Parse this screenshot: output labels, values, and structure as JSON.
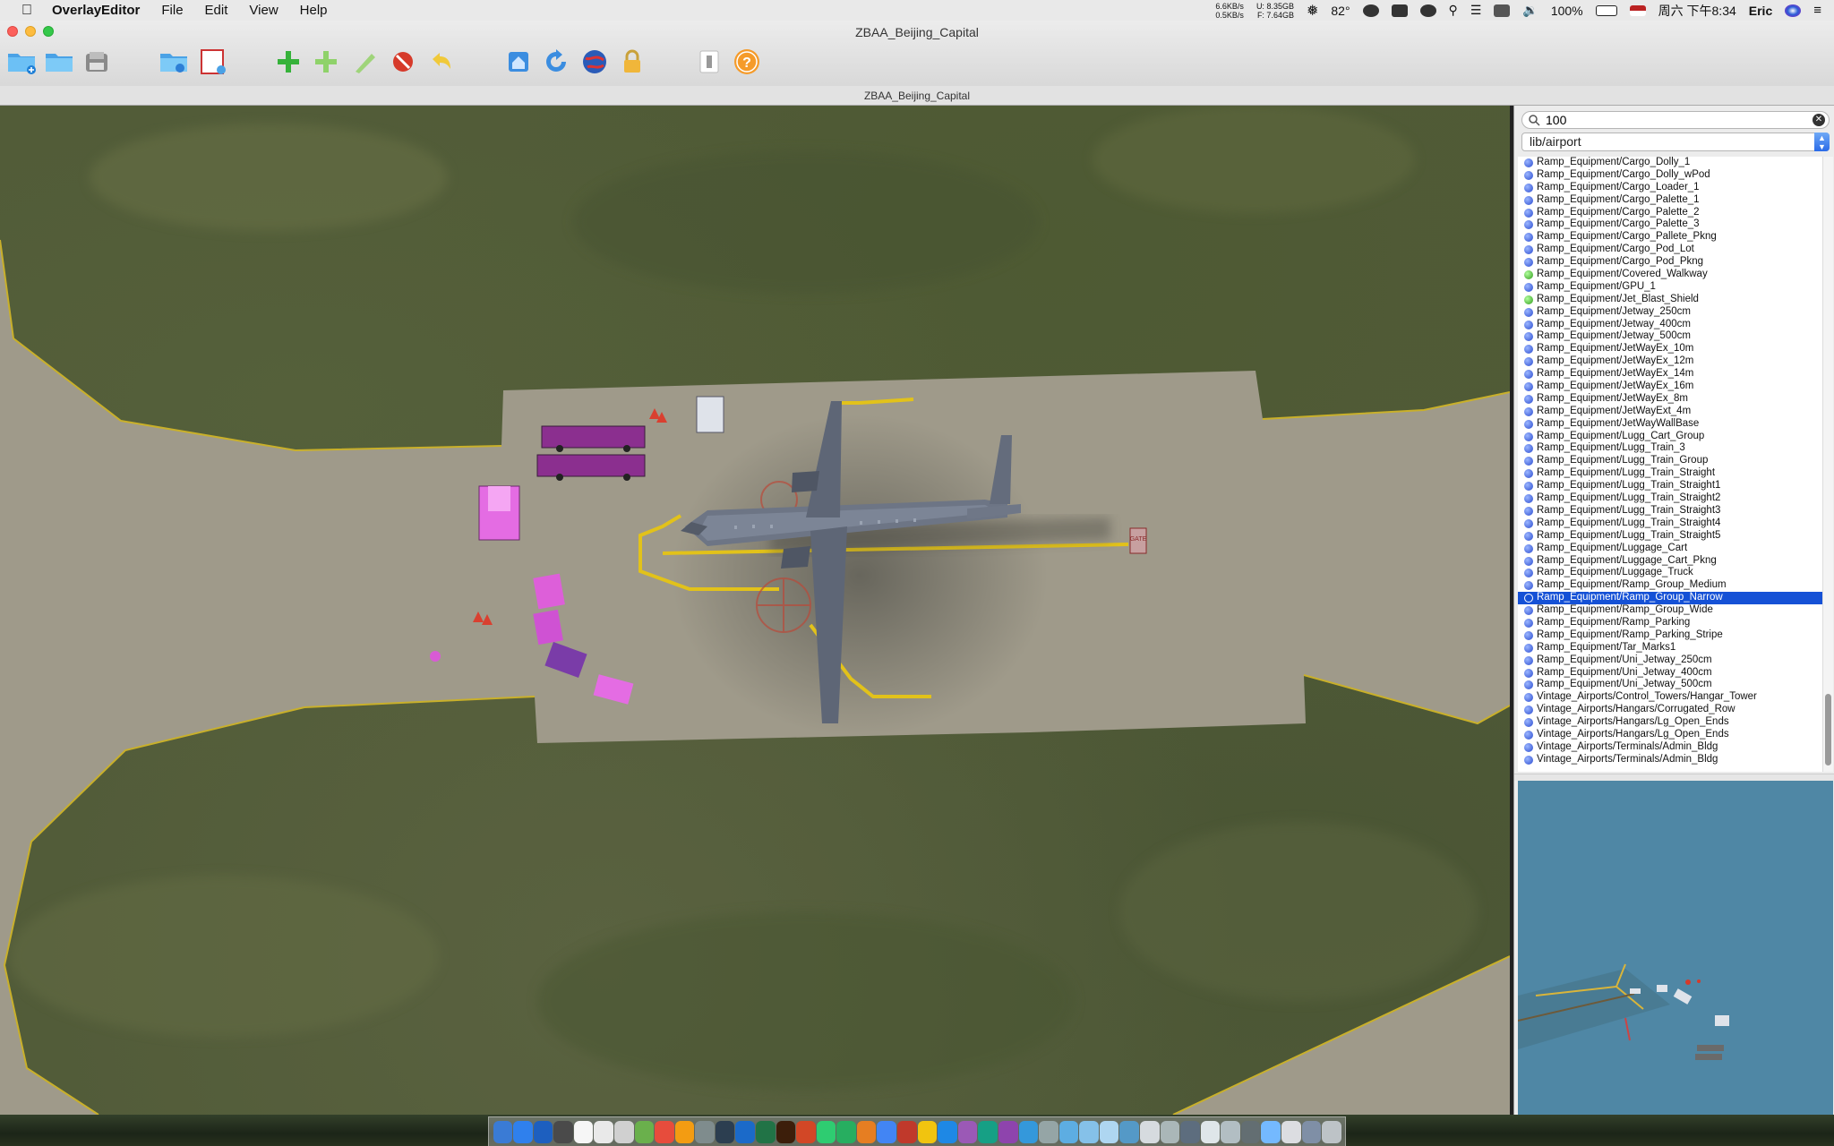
{
  "menubar": {
    "app_name": "OverlayEditor",
    "menus": [
      "File",
      "Edit",
      "View",
      "Help"
    ],
    "net_up": "6.6KB/s",
    "net_down": "0.5KB/s",
    "mem_used": "U: 8.35GB",
    "mem_free": "F: 7.64GB",
    "temperature": "82°",
    "battery": "100%",
    "datetime": "周六 下午8:34",
    "user": "Eric"
  },
  "window": {
    "title": "ZBAA_Beijing_Capital",
    "document_title": "ZBAA_Beijing_Capital"
  },
  "toolbar": {
    "icons": [
      "new-folder-icon",
      "open-folder-icon",
      "save-icon",
      "import-folder-icon",
      "import-image-icon",
      "add-object-icon",
      "add-polygon-icon",
      "edit-node-icon",
      "delete-icon",
      "undo-icon",
      "home-view-icon",
      "rotate-icon",
      "globe-icon",
      "lock-icon",
      "preferences-icon",
      "help-icon"
    ]
  },
  "panel": {
    "search_value": "100",
    "library_path": "lib/airport",
    "items": [
      {
        "label": "Ramp_Equipment/Cargo_Dolly_1",
        "color": "blue"
      },
      {
        "label": "Ramp_Equipment/Cargo_Dolly_wPod",
        "color": "blue"
      },
      {
        "label": "Ramp_Equipment/Cargo_Loader_1",
        "color": "blue"
      },
      {
        "label": "Ramp_Equipment/Cargo_Palette_1",
        "color": "blue"
      },
      {
        "label": "Ramp_Equipment/Cargo_Palette_2",
        "color": "blue"
      },
      {
        "label": "Ramp_Equipment/Cargo_Palette_3",
        "color": "blue"
      },
      {
        "label": "Ramp_Equipment/Cargo_Pallete_Pkng",
        "color": "blue"
      },
      {
        "label": "Ramp_Equipment/Cargo_Pod_Lot",
        "color": "blue"
      },
      {
        "label": "Ramp_Equipment/Cargo_Pod_Pkng",
        "color": "blue"
      },
      {
        "label": "Ramp_Equipment/Covered_Walkway",
        "color": "green"
      },
      {
        "label": "Ramp_Equipment/GPU_1",
        "color": "blue"
      },
      {
        "label": "Ramp_Equipment/Jet_Blast_Shield",
        "color": "green"
      },
      {
        "label": "Ramp_Equipment/Jetway_250cm",
        "color": "blue"
      },
      {
        "label": "Ramp_Equipment/Jetway_400cm",
        "color": "blue"
      },
      {
        "label": "Ramp_Equipment/Jetway_500cm",
        "color": "blue"
      },
      {
        "label": "Ramp_Equipment/JetWayEx_10m",
        "color": "blue"
      },
      {
        "label": "Ramp_Equipment/JetWayEx_12m",
        "color": "blue"
      },
      {
        "label": "Ramp_Equipment/JetWayEx_14m",
        "color": "blue"
      },
      {
        "label": "Ramp_Equipment/JetWayEx_16m",
        "color": "blue"
      },
      {
        "label": "Ramp_Equipment/JetWayEx_8m",
        "color": "blue"
      },
      {
        "label": "Ramp_Equipment/JetWayExt_4m",
        "color": "blue"
      },
      {
        "label": "Ramp_Equipment/JetWayWallBase",
        "color": "blue"
      },
      {
        "label": "Ramp_Equipment/Lugg_Cart_Group",
        "color": "blue"
      },
      {
        "label": "Ramp_Equipment/Lugg_Train_3",
        "color": "blue"
      },
      {
        "label": "Ramp_Equipment/Lugg_Train_Group",
        "color": "blue"
      },
      {
        "label": "Ramp_Equipment/Lugg_Train_Straight",
        "color": "blue"
      },
      {
        "label": "Ramp_Equipment/Lugg_Train_Straight1",
        "color": "blue"
      },
      {
        "label": "Ramp_Equipment/Lugg_Train_Straight2",
        "color": "blue"
      },
      {
        "label": "Ramp_Equipment/Lugg_Train_Straight3",
        "color": "blue"
      },
      {
        "label": "Ramp_Equipment/Lugg_Train_Straight4",
        "color": "blue"
      },
      {
        "label": "Ramp_Equipment/Lugg_Train_Straight5",
        "color": "blue"
      },
      {
        "label": "Ramp_Equipment/Luggage_Cart",
        "color": "blue"
      },
      {
        "label": "Ramp_Equipment/Luggage_Cart_Pkng",
        "color": "blue"
      },
      {
        "label": "Ramp_Equipment/Luggage_Truck",
        "color": "blue"
      },
      {
        "label": "Ramp_Equipment/Ramp_Group_Medium",
        "color": "blue"
      },
      {
        "label": "Ramp_Equipment/Ramp_Group_Narrow",
        "color": "blue",
        "selected": true
      },
      {
        "label": "Ramp_Equipment/Ramp_Group_Wide",
        "color": "blue"
      },
      {
        "label": "Ramp_Equipment/Ramp_Parking",
        "color": "blue"
      },
      {
        "label": "Ramp_Equipment/Ramp_Parking_Stripe",
        "color": "blue"
      },
      {
        "label": "Ramp_Equipment/Tar_Marks1",
        "color": "blue"
      },
      {
        "label": "Ramp_Equipment/Uni_Jetway_250cm",
        "color": "blue"
      },
      {
        "label": "Ramp_Equipment/Uni_Jetway_400cm",
        "color": "blue"
      },
      {
        "label": "Ramp_Equipment/Uni_Jetway_500cm",
        "color": "blue"
      },
      {
        "label": "Vintage_Airports/Control_Towers/Hangar_Tower",
        "color": "blue"
      },
      {
        "label": "Vintage_Airports/Hangars/Corrugated_Row",
        "color": "blue"
      },
      {
        "label": "Vintage_Airports/Hangars/Lg_Open_Ends",
        "color": "blue"
      },
      {
        "label": "Vintage_Airports/Hangars/Lg_Open_Ends",
        "color": "blue"
      },
      {
        "label": "Vintage_Airports/Terminals/Admin_Bldg",
        "color": "blue"
      },
      {
        "label": "Vintage_Airports/Terminals/Admin_Bldg",
        "color": "blue"
      }
    ]
  },
  "viewport": {
    "gate_sign": "GATE"
  },
  "colors": {
    "grass": "#515b38",
    "apron": "#9f9a8a",
    "taxi_line": "#e2c21a",
    "selection": "#1551d6",
    "preview_bg": "#4f87a5"
  }
}
